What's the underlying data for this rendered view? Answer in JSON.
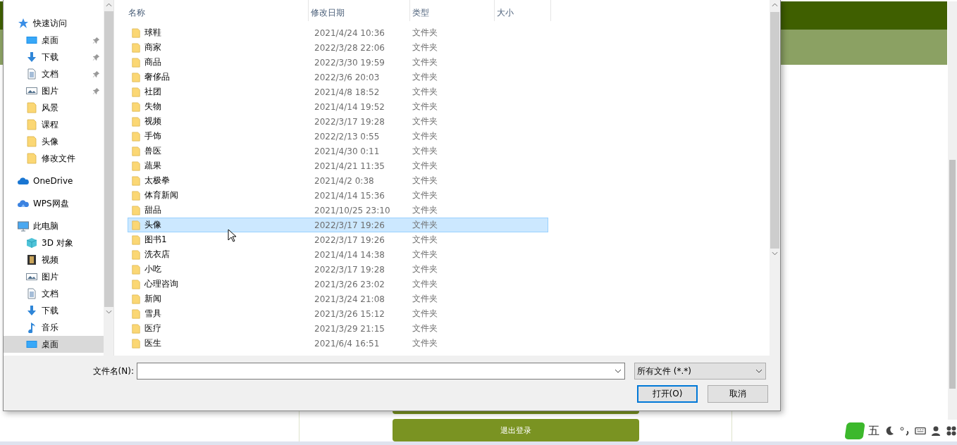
{
  "dialog": {
    "sidebar": [
      {
        "label": "快速访问",
        "kind": "star",
        "selected": false,
        "children": [
          {
            "label": "桌面",
            "kind": "desktop",
            "pinned": true,
            "selected": false
          },
          {
            "label": "下载",
            "kind": "download",
            "pinned": true,
            "selected": false
          },
          {
            "label": "文档",
            "kind": "document",
            "pinned": true,
            "selected": false
          },
          {
            "label": "图片",
            "kind": "picture",
            "pinned": true,
            "selected": false
          },
          {
            "label": "风景",
            "kind": "folder",
            "pinned": false,
            "selected": false
          },
          {
            "label": "课程",
            "kind": "folder",
            "pinned": false,
            "selected": false
          },
          {
            "label": "头像",
            "kind": "folder",
            "pinned": false,
            "selected": false
          },
          {
            "label": "修改文件",
            "kind": "folder",
            "pinned": false,
            "selected": false
          }
        ]
      },
      {
        "label": "OneDrive",
        "kind": "cloud",
        "selected": false
      },
      {
        "label": "WPS网盘",
        "kind": "cloud2",
        "selected": false
      },
      {
        "label": "此电脑",
        "kind": "pc",
        "selected": false,
        "children": [
          {
            "label": "3D 对象",
            "kind": "cube",
            "pinned": false,
            "selected": false
          },
          {
            "label": "视频",
            "kind": "video",
            "pinned": false,
            "selected": false
          },
          {
            "label": "图片",
            "kind": "picture",
            "pinned": false,
            "selected": false
          },
          {
            "label": "文档",
            "kind": "document",
            "pinned": false,
            "selected": false
          },
          {
            "label": "下载",
            "kind": "download",
            "pinned": false,
            "selected": false
          },
          {
            "label": "音乐",
            "kind": "music",
            "pinned": false,
            "selected": false
          },
          {
            "label": "桌面",
            "kind": "desktop",
            "pinned": false,
            "selected": true
          }
        ]
      }
    ],
    "columns": [
      "名称",
      "修改日期",
      "类型",
      "大小"
    ],
    "rows": [
      {
        "name": "球鞋",
        "date": "2021/4/24 10:36",
        "type": "文件夹",
        "selected": false
      },
      {
        "name": "商家",
        "date": "2022/3/28 22:06",
        "type": "文件夹",
        "selected": false
      },
      {
        "name": "商品",
        "date": "2022/3/30 19:59",
        "type": "文件夹",
        "selected": false
      },
      {
        "name": "奢侈品",
        "date": "2022/3/6 20:03",
        "type": "文件夹",
        "selected": false
      },
      {
        "name": "社团",
        "date": "2021/4/8 18:52",
        "type": "文件夹",
        "selected": false
      },
      {
        "name": "失物",
        "date": "2021/4/14 19:52",
        "type": "文件夹",
        "selected": false
      },
      {
        "name": "视频",
        "date": "2022/3/17 19:28",
        "type": "文件夹",
        "selected": false
      },
      {
        "name": "手饰",
        "date": "2022/2/13 0:55",
        "type": "文件夹",
        "selected": false
      },
      {
        "name": "兽医",
        "date": "2021/4/30 0:11",
        "type": "文件夹",
        "selected": false
      },
      {
        "name": "蔬果",
        "date": "2021/4/21 11:35",
        "type": "文件夹",
        "selected": false
      },
      {
        "name": "太极拳",
        "date": "2021/4/2 0:38",
        "type": "文件夹",
        "selected": false
      },
      {
        "name": "体育新闻",
        "date": "2021/4/14 15:36",
        "type": "文件夹",
        "selected": false
      },
      {
        "name": "甜品",
        "date": "2021/10/25 23:10",
        "type": "文件夹",
        "selected": false
      },
      {
        "name": "头像",
        "date": "2022/3/17 19:26",
        "type": "文件夹",
        "selected": true
      },
      {
        "name": "图书1",
        "date": "2022/3/17 19:26",
        "type": "文件夹",
        "selected": false
      },
      {
        "name": "洗衣店",
        "date": "2021/4/14 14:38",
        "type": "文件夹",
        "selected": false
      },
      {
        "name": "小吃",
        "date": "2022/3/17 19:28",
        "type": "文件夹",
        "selected": false
      },
      {
        "name": "心理咨询",
        "date": "2021/3/26 23:02",
        "type": "文件夹",
        "selected": false
      },
      {
        "name": "新闻",
        "date": "2021/3/24 21:08",
        "type": "文件夹",
        "selected": false
      },
      {
        "name": "雪具",
        "date": "2021/3/26 15:12",
        "type": "文件夹",
        "selected": false
      },
      {
        "name": "医疗",
        "date": "2021/3/29 21:15",
        "type": "文件夹",
        "selected": false
      },
      {
        "name": "医生",
        "date": "2021/6/4 16:51",
        "type": "文件夹",
        "selected": false
      }
    ],
    "filename_label": "文件名(N):",
    "filetype": "所有文件 (*.*)",
    "buttons": [
      "打开(O)",
      "取消"
    ]
  },
  "page": {
    "logout_button": "退出登录"
  },
  "ime": {
    "mode": "五"
  }
}
